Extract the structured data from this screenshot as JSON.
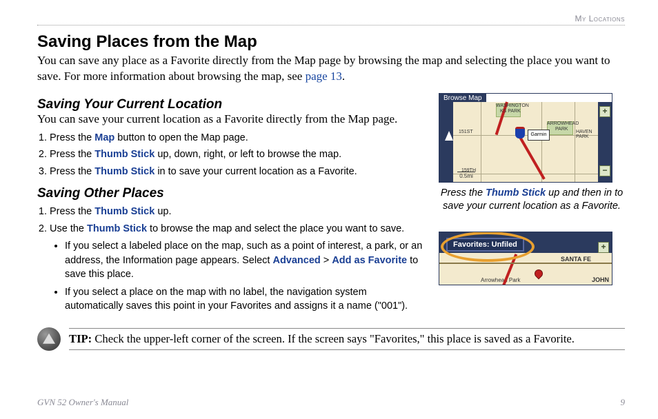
{
  "header": {
    "section_label": "My Locations"
  },
  "title": "Saving Places from the Map",
  "intro": {
    "part1": "You can save any place as a Favorite directly from the Map page by browsing the map and selecting the place you want to save. For more information about browsing the map, see ",
    "link": "page 13",
    "part2": "."
  },
  "section1": {
    "heading": "Saving Your Current Location",
    "desc": "You can save your current location as a Favorite directly from the Map page.",
    "steps": [
      {
        "pre": "Press the ",
        "term": "Map",
        "post": " button to open the Map page."
      },
      {
        "pre": "Press the ",
        "term": "Thumb Stick",
        "post": " up, down, right, or left to browse the map."
      },
      {
        "pre": "Press the ",
        "term": "Thumb Stick",
        "post": " in to save your current location as a Favorite."
      }
    ]
  },
  "figure1": {
    "map_title": "Browse Map",
    "pin_label": "Garmin",
    "labels": {
      "ks_park_top": "WASHINGTON",
      "ks_park": "KS PARK",
      "arrowhead": "ARROWHEAD",
      "park2": "PARK",
      "havenpark": "HAVEN PARK",
      "street151": "151ST",
      "street159": "159TH",
      "scale": "0.5mi"
    },
    "caption_pre": "Press the ",
    "caption_term": "Thumb Stick",
    "caption_post": " up and then in to save your current location as a Favorite."
  },
  "section2": {
    "heading": "Saving Other Places",
    "step1": {
      "pre": "Press the ",
      "term": "Thumb Stick",
      "post": " up."
    },
    "step2": {
      "pre": "Use the ",
      "term": "Thumb Stick",
      "post": " to browse the map and select the place you want to save."
    },
    "bullet1": {
      "pre": "If you select a labeled place on the map, such as a point of interest, a park, or an address, the Information page appears. Select ",
      "term1": "Advanced",
      "gt": " > ",
      "term2": "Add as Favorite",
      "post": " to save this place."
    },
    "bullet2": "If you select a place on the map with no label, the navigation system automatically saves this point in your Favorites and assigns it a name (\"001\")."
  },
  "figure2": {
    "fav_label": "Favorites: Unfiled",
    "santa_fe": "SANTA FE",
    "john": "JOHN",
    "arrowhead": "Arrowhead Park"
  },
  "tip": {
    "label": "TIP:",
    "text": " Check the upper-left corner of the screen. If the screen says \"Favorites,\" this place is saved as a Favorite."
  },
  "footer": {
    "manual": "GVN 52 Owner's Manual",
    "page": "9"
  }
}
